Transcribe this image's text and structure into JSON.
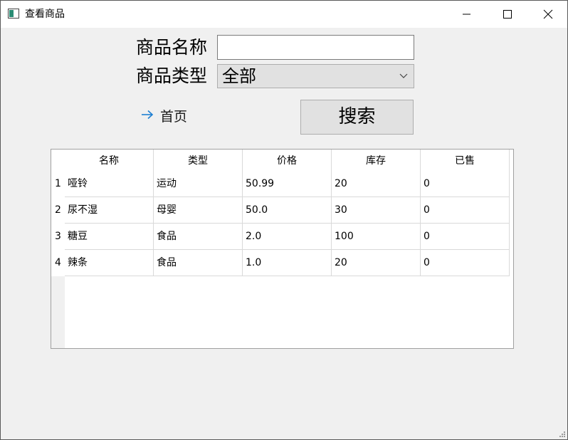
{
  "window": {
    "title": "查看商品"
  },
  "form": {
    "name_label": "商品名称",
    "name_value": "",
    "type_label": "商品类型",
    "type_value": "全部"
  },
  "home_link": "首页",
  "search_button": "搜索",
  "table": {
    "columns": [
      "名称",
      "类型",
      "价格",
      "库存",
      "已售"
    ],
    "row_numbers": [
      "1",
      "2",
      "3",
      "4"
    ],
    "rows": [
      [
        "哑铃",
        "运动",
        "50.99",
        "20",
        "0"
      ],
      [
        "尿不湿",
        "母婴",
        "50.0",
        "30",
        "0"
      ],
      [
        "糖豆",
        "食品",
        "2.0",
        "100",
        "0"
      ],
      [
        "辣条",
        "食品",
        "1.0",
        "20",
        "0"
      ]
    ]
  },
  "colors": {
    "window_bg": "#f0f0f0",
    "accent_arrow": "#1e7fd2",
    "button_bg": "#e1e1e1"
  },
  "icons": {
    "app": "app-window-icon",
    "minimize": "minimize-icon",
    "maximize": "maximize-icon",
    "close": "close-icon",
    "dropdown": "chevron-down-icon",
    "home": "arrow-right-icon",
    "resize": "resize-grip-icon"
  }
}
